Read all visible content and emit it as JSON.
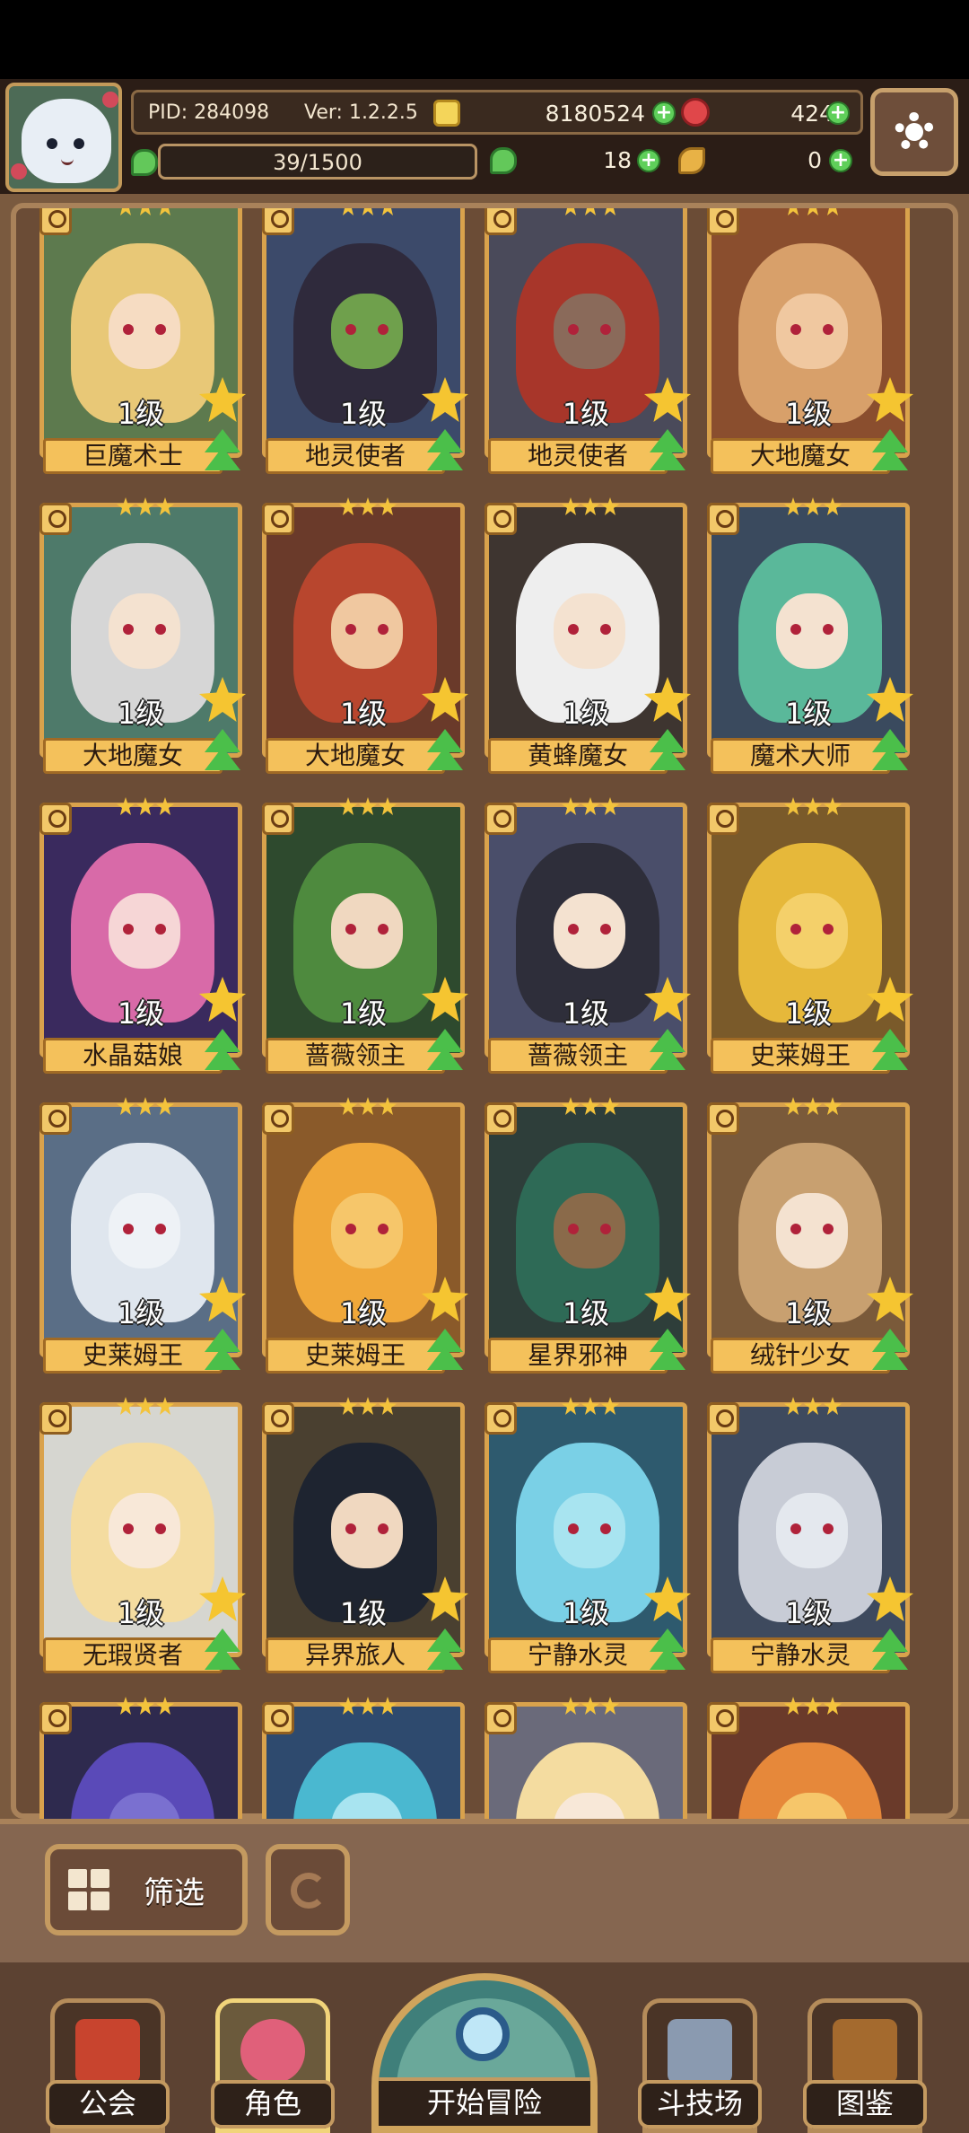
{
  "header": {
    "pid": "PID: 284098",
    "version": "Ver: 1.2.2.5",
    "gold": "8180524",
    "gems": "424",
    "energy": "39/1500",
    "clover": "18",
    "keys": "0",
    "plus": "+"
  },
  "cards": [
    {
      "level": "1级",
      "name": "巨魔术士",
      "hair": "#e8c877",
      "skin": "#f6dcc2",
      "bg": "#5d7a4e"
    },
    {
      "level": "1级",
      "name": "地灵使者",
      "hair": "#2f2a3c",
      "skin": "#6fa04c",
      "bg": "#3c4a6a"
    },
    {
      "level": "1级",
      "name": "地灵使者",
      "hair": "#a8362a",
      "skin": "#8a6a5a",
      "bg": "#4a4a5a"
    },
    {
      "level": "1级",
      "name": "大地魔女",
      "hair": "#d8a06a",
      "skin": "#f0c8a0",
      "bg": "#8a4e2e"
    },
    {
      "level": "1级",
      "name": "大地魔女",
      "hair": "#d6d6d6",
      "skin": "#f4e2d0",
      "bg": "#4e7a6a"
    },
    {
      "level": "1级",
      "name": "大地魔女",
      "hair": "#b8462e",
      "skin": "#f0c8a0",
      "bg": "#6a3a2a"
    },
    {
      "level": "1级",
      "name": "黄蜂魔女",
      "hair": "#eeeeee",
      "skin": "#f4e2d0",
      "bg": "#3e3530"
    },
    {
      "level": "1级",
      "name": "魔术大师",
      "hair": "#5ab89a",
      "skin": "#f4e2d0",
      "bg": "#3a4a5e"
    },
    {
      "level": "1级",
      "name": "水晶菇娘",
      "hair": "#d86aa8",
      "skin": "#f6d6d6",
      "bg": "#3a2a5e"
    },
    {
      "level": "1级",
      "name": "蔷薇领主",
      "hair": "#4e8a3e",
      "skin": "#f0d8c0",
      "bg": "#2e4a2e"
    },
    {
      "level": "1级",
      "name": "蔷薇领主",
      "hair": "#2e2e3a",
      "skin": "#f4e2d0",
      "bg": "#4a4e6a"
    },
    {
      "level": "1级",
      "name": "史莱姆王",
      "hair": "#e6b83a",
      "skin": "#f4d06a",
      "bg": "#7a5a2a"
    },
    {
      "level": "1级",
      "name": "史莱姆王",
      "hair": "#dfe6ee",
      "skin": "#eef2f6",
      "bg": "#5a6e86"
    },
    {
      "level": "1级",
      "name": "史莱姆王",
      "hair": "#f0a83a",
      "skin": "#f6c66a",
      "bg": "#8a5a2a"
    },
    {
      "level": "1级",
      "name": "星界邪神",
      "hair": "#2e6a56",
      "skin": "#8a6a4a",
      "bg": "#2e3e3a"
    },
    {
      "level": "1级",
      "name": "绒针少女",
      "hair": "#c8a070",
      "skin": "#f4e2d0",
      "bg": "#7a5a3a"
    },
    {
      "level": "1级",
      "name": "无瑕贤者",
      "hair": "#f4dca0",
      "skin": "#f8e8d8",
      "bg": "#d6d6d0"
    },
    {
      "level": "1级",
      "name": "异界旅人",
      "hair": "#1e2430",
      "skin": "#f0d8c0",
      "bg": "#4a4030"
    },
    {
      "level": "1级",
      "name": "宁静水灵",
      "hair": "#7ad0e6",
      "skin": "#a8e4f0",
      "bg": "#2e5a6e"
    },
    {
      "level": "1级",
      "name": "宁静水灵",
      "hair": "#c8ccd6",
      "skin": "#e4e8ee",
      "bg": "#3e4a5e"
    },
    {
      "level": "",
      "name": "",
      "hair": "#5a4ab8",
      "skin": "#7a70d0",
      "bg": "#2e2a4e"
    },
    {
      "level": "",
      "name": "",
      "hair": "#4ab8d0",
      "skin": "#a8e4f0",
      "bg": "#2e4a6e"
    },
    {
      "level": "",
      "name": "",
      "hair": "#f4dca0",
      "skin": "#f8e8d8",
      "bg": "#6a6a7a"
    },
    {
      "level": "",
      "name": "",
      "hair": "#e6883a",
      "skin": "#f6c66a",
      "bg": "#6a3a2a"
    }
  ],
  "controls": {
    "filter_label": "筛选"
  },
  "nav": {
    "guild": "公会",
    "character": "角色",
    "adventure": "开始冒险",
    "arena": "斗技场",
    "codex": "图鉴"
  },
  "colors": {
    "frame_gold": "#d9a24c",
    "name_plate": "#f4c15b",
    "upgrade_green": "#4bbf4a"
  }
}
